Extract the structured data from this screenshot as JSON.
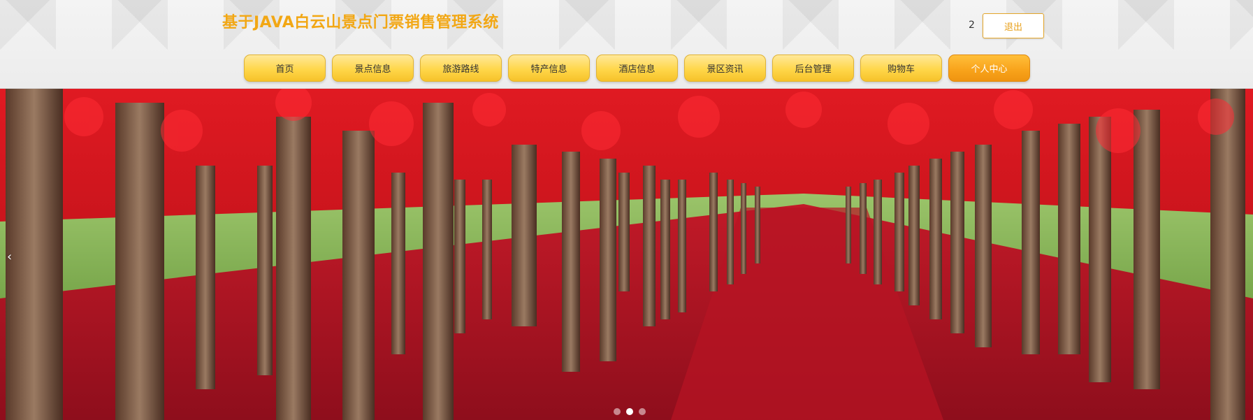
{
  "header": {
    "title": "基于JAVA白云山景点门票销售管理系统",
    "user_count": "2",
    "logout_label": "退出"
  },
  "nav": {
    "items": [
      {
        "label": "首页"
      },
      {
        "label": "景点信息"
      },
      {
        "label": "旅游路线"
      },
      {
        "label": "特产信息"
      },
      {
        "label": "酒店信息"
      },
      {
        "label": "景区资讯"
      },
      {
        "label": "后台管理"
      },
      {
        "label": "购物车"
      },
      {
        "label": "个人中心",
        "active": true
      }
    ]
  },
  "banner": {
    "prev_arrow": "‹",
    "slides": 3,
    "active_slide": 2
  },
  "colors": {
    "title": "#f2a714",
    "nav_bg": "#ffd74a",
    "nav_active": "#f8a21a",
    "banner_red": "#c41a20"
  }
}
